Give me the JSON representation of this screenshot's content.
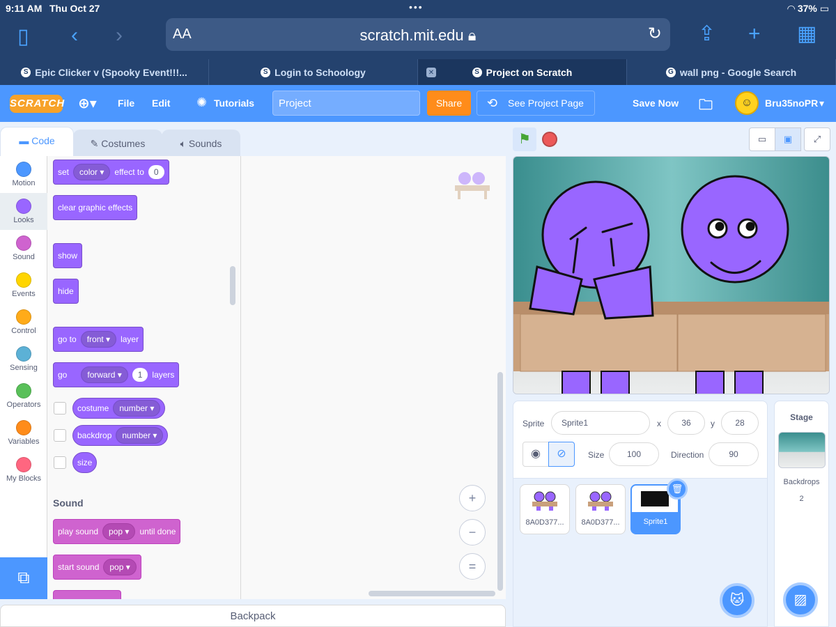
{
  "status": {
    "time": "9:11 AM",
    "date": "Thu Oct 27",
    "wifi_battery": "37%"
  },
  "safari": {
    "aa": "AA",
    "url": "scratch.mit.edu"
  },
  "tabs": [
    {
      "title": "Epic Clicker v (Spooky Event!!!..."
    },
    {
      "title": "Login to Schoology"
    },
    {
      "title": "Project on Scratch"
    },
    {
      "title": "wall png - Google Search"
    }
  ],
  "menu": {
    "logo": "SCRATCH",
    "file": "File",
    "edit": "Edit",
    "tutorials": "Tutorials",
    "project_title": "Project",
    "share": "Share",
    "see_project_page": "See Project Page",
    "save_now": "Save Now",
    "username": "Bru35noPR"
  },
  "editor_tabs": {
    "code": "Code",
    "costumes": "Costumes",
    "sounds": "Sounds"
  },
  "categories": [
    {
      "label": "Motion",
      "color": "#4c97ff"
    },
    {
      "label": "Looks",
      "color": "#9966ff"
    },
    {
      "label": "Sound",
      "color": "#cf63cf"
    },
    {
      "label": "Events",
      "color": "#ffd500"
    },
    {
      "label": "Control",
      "color": "#ffab19"
    },
    {
      "label": "Sensing",
      "color": "#5cb1d6"
    },
    {
      "label": "Operators",
      "color": "#59c059"
    },
    {
      "label": "Variables",
      "color": "#ff8c1a"
    },
    {
      "label": "My Blocks",
      "color": "#ff6680"
    }
  ],
  "blocks": {
    "set_effect": {
      "a": "set",
      "b": "color",
      "c": "effect to",
      "d": "0"
    },
    "clear_effects": "clear graphic effects",
    "show": "show",
    "hide": "hide",
    "go_to_layer": {
      "a": "go to",
      "b": "front",
      "c": "layer"
    },
    "go_layers": {
      "a": "go",
      "b": "forward",
      "c": "1",
      "d": "layers"
    },
    "costume": {
      "a": "costume",
      "b": "number"
    },
    "backdrop": {
      "a": "backdrop",
      "b": "number"
    },
    "size": "size",
    "sound_heading": "Sound",
    "play_sound": {
      "a": "play sound",
      "b": "pop",
      "c": "until done"
    },
    "start_sound": {
      "a": "start sound",
      "b": "pop"
    }
  },
  "zoom": {
    "in": "+",
    "out": "−",
    "reset": "="
  },
  "backpack": "Backpack",
  "sprite_info": {
    "sprite_label": "Sprite",
    "sprite_name": "Sprite1",
    "x_label": "x",
    "x": "36",
    "y_label": "y",
    "y": "28",
    "size_label": "Size",
    "size": "100",
    "direction_label": "Direction",
    "direction": "90"
  },
  "sprites": [
    {
      "name": "8A0D377..."
    },
    {
      "name": "8A0D377..."
    },
    {
      "name": "Sprite1"
    }
  ],
  "stage_panel": {
    "title": "Stage",
    "backdrops_label": "Backdrops",
    "backdrops_count": "2"
  }
}
